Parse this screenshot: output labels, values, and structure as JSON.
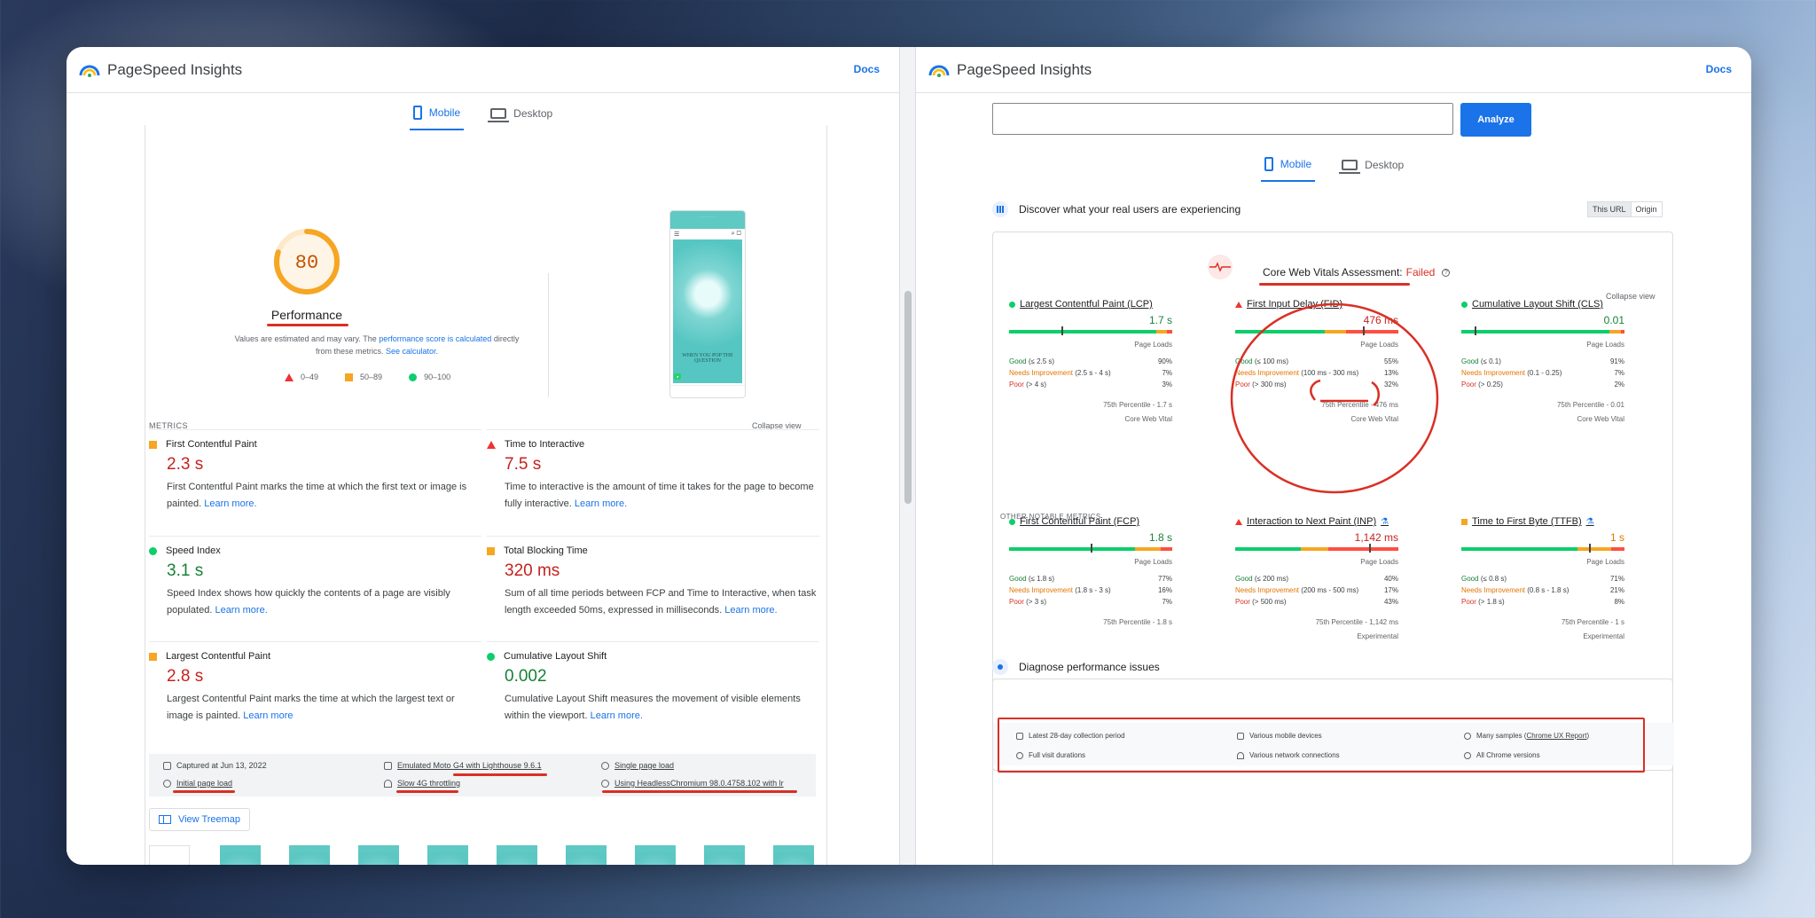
{
  "colors": {
    "accent": "#1a73e8",
    "fail": "#d93025",
    "good": "#0cce6b",
    "average": "#f6a623",
    "poor": "#ff4e42",
    "annotation": "#d93025"
  },
  "left": {
    "brand": "PageSpeed Insights",
    "docs": "Docs",
    "tabs": [
      "Mobile",
      "Desktop"
    ],
    "score": "80",
    "score_fraction": 0.8,
    "score_label": "Performance",
    "note_prefix": "Values are estimated and may vary. The ",
    "note_link1": "performance score is calculated",
    "note_mid": " directly from these metrics. ",
    "note_link2": "See calculator.",
    "legend": [
      "0–49",
      "50–89",
      "90–100"
    ],
    "metrics_heading": "METRICS",
    "collapse": "Collapse view",
    "metrics": [
      {
        "name": "First Contentful Paint",
        "value": "2.3 s",
        "status": "average",
        "desc": "First Contentful Paint marks the time at which the first text or image is painted.",
        "link": "Learn more."
      },
      {
        "name": "Time to Interactive",
        "value": "7.5 s",
        "status": "poor",
        "desc": "Time to interactive is the amount of time it takes for the page to become fully interactive.",
        "link": "Learn more."
      },
      {
        "name": "Speed Index",
        "value": "3.1 s",
        "status": "good",
        "desc": "Speed Index shows how quickly the contents of a page are visibly populated.",
        "link": "Learn more."
      },
      {
        "name": "Total Blocking Time",
        "value": "320 ms",
        "status": "average",
        "desc": "Sum of all time periods between FCP and Time to Interactive, when task length exceeded 50ms, expressed in milliseconds.",
        "link": "Learn more."
      },
      {
        "name": "Largest Contentful Paint",
        "value": "2.8 s",
        "status": "average",
        "desc": "Largest Contentful Paint marks the time at which the largest text or image is painted.",
        "link": "Learn more"
      },
      {
        "name": "Cumulative Layout Shift",
        "value": "0.002",
        "status": "good",
        "desc": "Cumulative Layout Shift measures the movement of visible elements within the viewport.",
        "link": "Learn more."
      }
    ],
    "run_info": {
      "captured": "Captured at Jun 13, 2022",
      "device": "Emulated Moto G4 with Lighthouse 9.6.1",
      "single": "Single page load",
      "initial": "Initial page load",
      "throttle": "Slow 4G throttling",
      "browser": "Using HeadlessChromium 98.0.4758.102 with lr"
    },
    "treemap": "View Treemap",
    "phone_hero": "WHEN YOU POP THE QUESTION"
  },
  "right": {
    "brand": "PageSpeed Insights",
    "docs": "Docs",
    "url_value": "",
    "analyze": "Analyze",
    "tabs": [
      "Mobile",
      "Desktop"
    ],
    "discover": "Discover what your real users are experiencing",
    "toggle": [
      "This URL",
      "Origin"
    ],
    "assessment_label": "Core Web Vitals Assessment:",
    "assessment_status": "Failed",
    "collapse": "Collapse view",
    "other_heading": "OTHER NOTABLE METRICS",
    "field_metrics": [
      {
        "name": "Largest Contentful Paint (LCP)",
        "value": "1.7 s",
        "status": "good",
        "dist": [
          90,
          7,
          3
        ],
        "pin": 0.32,
        "page_loads": "Page Loads",
        "good": "Good",
        "good_t": "(≤ 2.5 s)",
        "ni": "Needs Improvement",
        "ni_t": "(2.5 s - 4 s)",
        "poor": "Poor",
        "poor_t": "(> 4 s)",
        "p75": "75th Percentile - 1.7 s",
        "foot": "Core Web Vital",
        "exp": false
      },
      {
        "name": "First Input Delay (FID)",
        "value": "476 ms",
        "status": "poor",
        "dist": [
          55,
          13,
          32
        ],
        "pin": 0.78,
        "page_loads": "Page Loads",
        "good": "Good",
        "good_t": "(≤ 100 ms)",
        "ni": "Needs Improvement",
        "ni_t": "(100 ms - 300 ms)",
        "poor": "Poor",
        "poor_t": "(> 300 ms)",
        "p75": "75th Percentile - 476 ms",
        "foot": "Core Web Vital",
        "exp": false
      },
      {
        "name": "Cumulative Layout Shift (CLS)",
        "value": "0.01",
        "status": "good",
        "dist": [
          91,
          7,
          2
        ],
        "pin": 0.08,
        "page_loads": "Page Loads",
        "good": "Good",
        "good_t": "(≤ 0.1)",
        "ni": "Needs Improvement",
        "ni_t": "(0.1 - 0.25)",
        "poor": "Poor",
        "poor_t": "(> 0.25)",
        "p75": "75th Percentile - 0.01",
        "foot": "Core Web Vital",
        "exp": false
      },
      {
        "name": "First Contentful Paint (FCP)",
        "value": "1.8 s",
        "status": "good",
        "dist": [
          77,
          16,
          7
        ],
        "pin": 0.5,
        "page_loads": "Page Loads",
        "good": "Good",
        "good_t": "(≤ 1.8 s)",
        "ni": "Needs Improvement",
        "ni_t": "(1.8 s - 3 s)",
        "poor": "Poor",
        "poor_t": "(> 3 s)",
        "p75": "75th Percentile - 1.8 s",
        "foot": "",
        "exp": false
      },
      {
        "name": "Interaction to Next Paint (INP)",
        "value": "1,142 ms",
        "status": "poor",
        "dist": [
          40,
          17,
          43
        ],
        "pin": 0.82,
        "page_loads": "Page Loads",
        "good": "Good",
        "good_t": "(≤ 200 ms)",
        "ni": "Needs Improvement",
        "ni_t": "(200 ms - 500 ms)",
        "poor": "Poor",
        "poor_t": "(> 500 ms)",
        "p75": "75th Percentile - 1,142 ms",
        "foot": "Experimental",
        "exp": true
      },
      {
        "name": "Time to First Byte (TTFB)",
        "value": "1 s",
        "status": "average",
        "dist": [
          71,
          21,
          8
        ],
        "pin": 0.78,
        "page_loads": "Page Loads",
        "good": "Good",
        "good_t": "(≤ 0.8 s)",
        "ni": "Needs Improvement",
        "ni_t": "(0.8 s - 1.8 s)",
        "poor": "Poor",
        "poor_t": "(> 1.8 s)",
        "p75": "75th Percentile - 1 s",
        "foot": "Experimental",
        "exp": true
      }
    ],
    "cwv_footer": {
      "period": "Latest 28-day collection period",
      "devices": "Various mobile devices",
      "samples_prefix": "Many samples (",
      "samples_link": "Chrome UX Report",
      "samples_suffix": ")",
      "durations": "Full visit durations",
      "network": "Various network connections",
      "versions": "All Chrome versions"
    },
    "diagnose": "Diagnose performance issues"
  }
}
